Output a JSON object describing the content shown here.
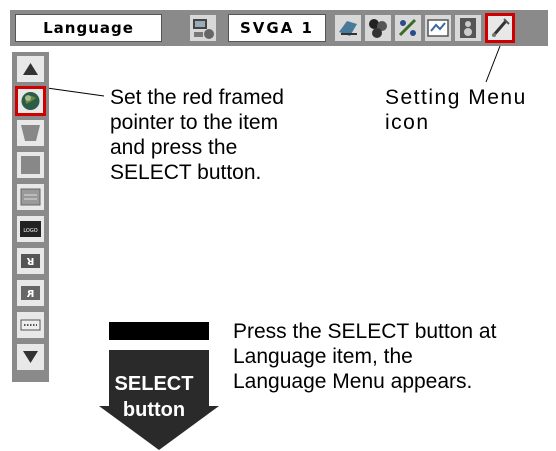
{
  "menu_bar": {
    "language_label": "Language",
    "input_label": "SVGA 1",
    "icons": [
      "pc-adjust-icon",
      "image-select-icon",
      "color-icon",
      "screen-icon",
      "sound-icon",
      "setting-menu-icon"
    ]
  },
  "sidebar": {
    "items": [
      "up-arrow-icon",
      "language-globe-icon",
      "keystone-icon",
      "blue-back-icon",
      "display-icon",
      "logo-icon",
      "ceiling-icon",
      "rear-icon",
      "terminal-icon",
      "down-arrow-icon"
    ],
    "selected_index": 1
  },
  "callouts": {
    "pointer_line1": "Set the red framed",
    "pointer_line2": "pointer to the item",
    "pointer_line3": "and press the",
    "pointer_line4": "SELECT button.",
    "setting_line1": "Setting Menu",
    "setting_line2": "icon",
    "note_line1": "Press the SELECT button at",
    "note_line2": "Language item, the",
    "note_line3": "Language Menu appears."
  },
  "select_arrow": {
    "line1": "SELECT",
    "line2": "button"
  },
  "colors": {
    "bar_gray": "#8a8a8a",
    "highlight_red": "#d00000",
    "arrow_dark": "#2a2a2a"
  }
}
